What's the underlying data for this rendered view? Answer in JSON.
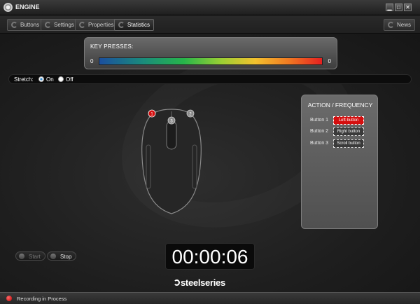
{
  "window": {
    "title": "ENGINE",
    "minimize_glyph": "▁",
    "maximize_glyph": "□",
    "close_glyph": "✕"
  },
  "tabs": [
    {
      "label": "Buttons",
      "icon": "refresh-icon"
    },
    {
      "label": "Settings",
      "icon": "refresh-icon"
    },
    {
      "label": "Properties",
      "icon": "refresh-icon"
    },
    {
      "label": "Statistics",
      "icon": "refresh-icon",
      "active": true
    }
  ],
  "news": {
    "label": "News"
  },
  "key_presses": {
    "title": "KEY PRESSES:",
    "min": "0",
    "max": "0",
    "gradient_colors": [
      "#1b4f9e",
      "#27b54a",
      "#f2c12e",
      "#e62020"
    ]
  },
  "stretch": {
    "label": "Stretch:",
    "options": [
      {
        "label": "On",
        "selected": true
      },
      {
        "label": "Off",
        "selected": false
      }
    ]
  },
  "mouse": {
    "markers": [
      "1",
      "2",
      "3"
    ],
    "marker_colors": {
      "1": "#d40f0f",
      "2": "#8a8a8a",
      "3": "#8a8a8a"
    }
  },
  "action_frequency": {
    "title": "ACTION / FREQUENCY",
    "rows": [
      {
        "label": "Button 1",
        "action": "Left button",
        "highlight": true
      },
      {
        "label": "Button 2",
        "action": "Right button",
        "highlight": false
      },
      {
        "label": "Button 3",
        "action": "Scroll button",
        "highlight": false
      }
    ]
  },
  "controls": {
    "start_label": "Start",
    "stop_label": "Stop"
  },
  "timer": {
    "value": "00:00:06"
  },
  "brand": {
    "name": "steelseries"
  },
  "status": {
    "text": "Recording in Process",
    "dot_color": "#d40f0f"
  }
}
